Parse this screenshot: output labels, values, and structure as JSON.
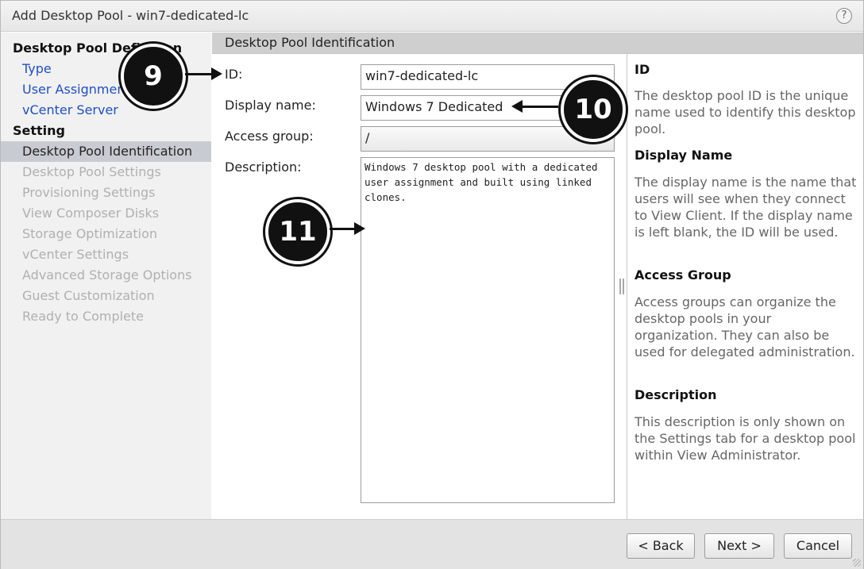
{
  "window": {
    "title": "Add Desktop Pool - win7-dedicated-lc",
    "help_icon": "?"
  },
  "nav": {
    "items": [
      {
        "label": "Desktop Pool Definition",
        "state": "header"
      },
      {
        "label": "Type",
        "state": "link"
      },
      {
        "label": "User Assignment",
        "state": "link"
      },
      {
        "label": "vCenter Server",
        "state": "link"
      },
      {
        "label": "Setting",
        "state": "header"
      },
      {
        "label": "Desktop Pool Identification",
        "state": "active"
      },
      {
        "label": "Desktop Pool Settings",
        "state": "disabled"
      },
      {
        "label": "Provisioning Settings",
        "state": "disabled"
      },
      {
        "label": "View Composer Disks",
        "state": "disabled"
      },
      {
        "label": "Storage Optimization",
        "state": "disabled"
      },
      {
        "label": "vCenter Settings",
        "state": "disabled"
      },
      {
        "label": "Advanced Storage Options",
        "state": "disabled"
      },
      {
        "label": "Guest Customization",
        "state": "disabled"
      },
      {
        "label": "Ready to Complete",
        "state": "disabled"
      }
    ]
  },
  "section": {
    "title": "Desktop Pool Identification"
  },
  "form": {
    "id_label": "ID:",
    "id_value": "win7-dedicated-lc",
    "display_name_label": "Display name:",
    "display_name_value": "Windows 7 Dedicated",
    "access_group_label": "Access group:",
    "access_group_value": "/",
    "description_label": "Description:",
    "description_value": "Windows 7 desktop pool with a dedicated user assignment and built using linked clones."
  },
  "help": {
    "id_title": "ID",
    "id_text": "The desktop pool ID is the unique name used to identify this desktop pool.",
    "display_title": "Display Name",
    "display_text": "The display name is the name that users will see when they connect to View Client. If the display name is left blank, the ID will be used.",
    "access_title": "Access Group",
    "access_text": "Access groups can organize the desktop pools in your organization. They can also be used for delegated administration.",
    "description_title": "Description",
    "description_text": "This description is only shown on the Settings tab for a desktop pool within View Administrator."
  },
  "footer": {
    "back": "< Back",
    "next": "Next >",
    "cancel": "Cancel"
  },
  "callouts": {
    "c9": "9",
    "c10": "10",
    "c11": "11"
  }
}
